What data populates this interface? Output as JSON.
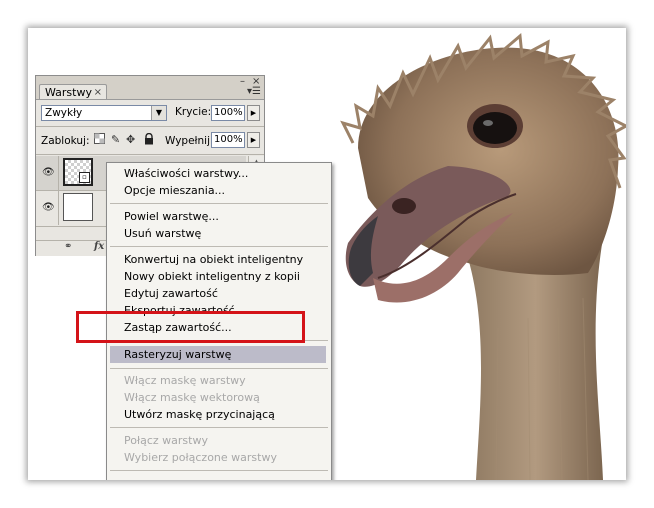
{
  "layers_panel": {
    "tab_title": "Warstwy",
    "tab_close_glyph": "×",
    "minimize_glyph": "–",
    "close_glyph": "×",
    "menu_glyph": "▾☰",
    "blend_mode": "Zwykły",
    "opacity_label": "Krycie:",
    "opacity_value": "100%",
    "lock_label": "Zablokuj:",
    "fill_label": "Wypełnij:",
    "fill_value": "100%",
    "lock_icons": [
      "transparency-lock-icon",
      "brush-icon",
      "move-icon",
      "lock-icon"
    ],
    "layers": [
      {
        "thumbnail": "smart-object-thumbnail",
        "visible": true
      },
      {
        "thumbnail": "white-thumbnail",
        "visible": true
      }
    ],
    "footer_icons": [
      "link-icon",
      "fx-icon"
    ],
    "footer_fx": "fx"
  },
  "context_menu": {
    "groups": [
      [
        {
          "label": "Właściwości warstwy...",
          "enabled": true
        },
        {
          "label": "Opcje mieszania...",
          "enabled": true
        }
      ],
      [
        {
          "label": "Powiel warstwę...",
          "enabled": true
        },
        {
          "label": "Usuń warstwę",
          "enabled": true
        }
      ],
      [
        {
          "label": "Konwertuj na obiekt inteligentny",
          "enabled": true
        },
        {
          "label": "Nowy obiekt inteligentny z kopii",
          "enabled": true
        },
        {
          "label": "Edytuj zawartość",
          "enabled": true
        },
        {
          "label": "Eksportuj zawartość...",
          "enabled": true
        },
        {
          "label": "Zastąp zawartość...",
          "enabled": true
        }
      ],
      [
        {
          "label": "Rasteryzuj warstwę",
          "enabled": true,
          "highlighted": true
        }
      ],
      [
        {
          "label": "Włącz maskę warstwy",
          "enabled": false
        },
        {
          "label": "Włącz maskę wektorową",
          "enabled": false
        },
        {
          "label": "Utwórz maskę przycinającą",
          "enabled": true
        }
      ],
      [
        {
          "label": "Połącz warstwy",
          "enabled": false
        },
        {
          "label": "Wybierz połączone warstwy",
          "enabled": false
        }
      ]
    ]
  },
  "colors": {
    "highlight": "#bcbbc9",
    "annotation_box": "#d41318",
    "panel_bg": "#e8e6e1"
  }
}
